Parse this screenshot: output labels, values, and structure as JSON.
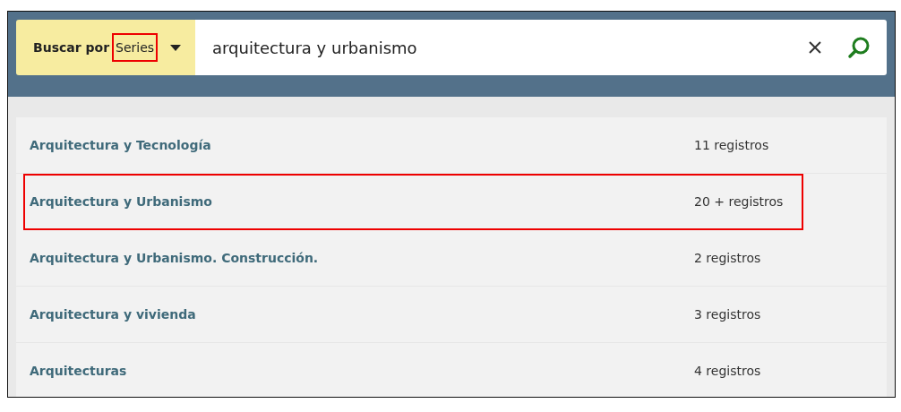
{
  "search": {
    "scope_label": "Buscar por",
    "scope_value": "Series",
    "scope_highlighted": true,
    "query": "arquitectura y urbanismo"
  },
  "results": [
    {
      "title": "Arquitectura y Tecnología",
      "count": "11 registros",
      "highlighted": false
    },
    {
      "title": "Arquitectura y Urbanismo",
      "count": "20 + registros",
      "highlighted": true
    },
    {
      "title": "Arquitectura y Urbanismo. Construcción.",
      "count": "2 registros",
      "highlighted": false
    },
    {
      "title": "Arquitectura y vivienda",
      "count": "3 registros",
      "highlighted": false
    },
    {
      "title": "Arquitecturas",
      "count": "4 registros",
      "highlighted": false
    }
  ]
}
